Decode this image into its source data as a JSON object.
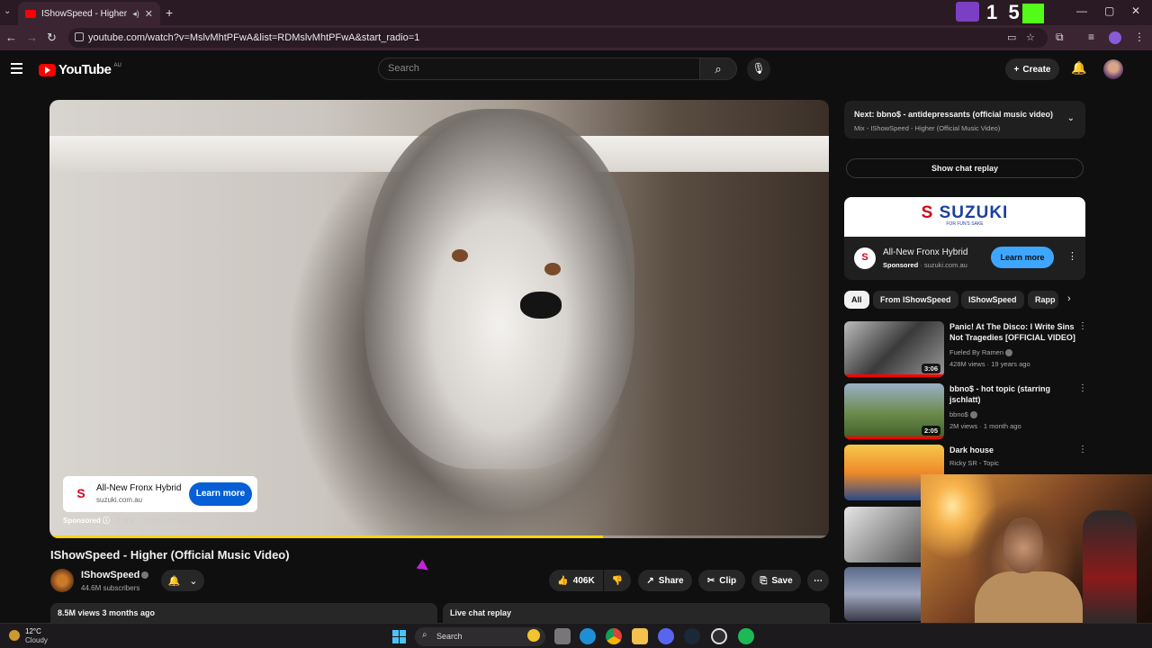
{
  "browser": {
    "tab_title": "IShowSpeed - Higher (Offici...",
    "url": "youtube.com/watch?v=MslvMhtPFwA&list=RDMslvMhtPFwA&start_radio=1",
    "overlay_digits": "1  5"
  },
  "youtube": {
    "logo_text": "YouTube",
    "country_code": "AU",
    "search_placeholder": "Search",
    "create_label": "Create"
  },
  "player": {
    "progress": 0.71,
    "ad": {
      "title": "All-New Fronx Hybrid",
      "domain": "suzuki.com.au",
      "cta": "Learn more",
      "sponsored": "Sponsored",
      "count": "· 2 of 2",
      "domain2": "suzuki.com.au"
    }
  },
  "video": {
    "title": "IShowSpeed - Higher (Official Music Video)",
    "channel": "IShowSpeed",
    "subscribers": "44.6M subscribers",
    "likes": "406K",
    "share": "Share",
    "clip": "Clip",
    "save": "Save",
    "views_line": "8.5M views  3 months ago",
    "live_chat": "Live chat replay"
  },
  "sidebar": {
    "next_title": "Next: bbno$ - antidepressants (official music video)",
    "next_mix": "Mix - IShowSpeed - Higher (Official Music Video)",
    "show_chat": "Show chat replay",
    "ad_brand": "SUZUKI",
    "ad_tagline": "FOR FUN'S SAKE",
    "ad_title": "All-New Fronx Hybrid",
    "ad_sponsored": "Sponsored",
    "ad_domain": "suzuki.com.au",
    "ad_cta": "Learn more",
    "chips": [
      "All",
      "From IShowSpeed",
      "IShowSpeed",
      "Rapp"
    ],
    "recs": [
      {
        "title": "Panic! At The Disco: I Write Sins Not Tragedies [OFFICIAL VIDEO]",
        "channel": "Fueled By Ramen",
        "meta": "428M views · 19 years ago",
        "duration": "3:06"
      },
      {
        "title": "bbno$ - hot topic (starring jschlatt)",
        "channel": "bbno$",
        "meta": "2M views · 1 month ago",
        "duration": "2:05"
      },
      {
        "title": "Dark house",
        "channel": "Ricky SR - Topic",
        "meta": "",
        "duration": ""
      }
    ]
  },
  "taskbar": {
    "temp": "12°C",
    "condition": "Cloudy",
    "search_label": "Search"
  }
}
